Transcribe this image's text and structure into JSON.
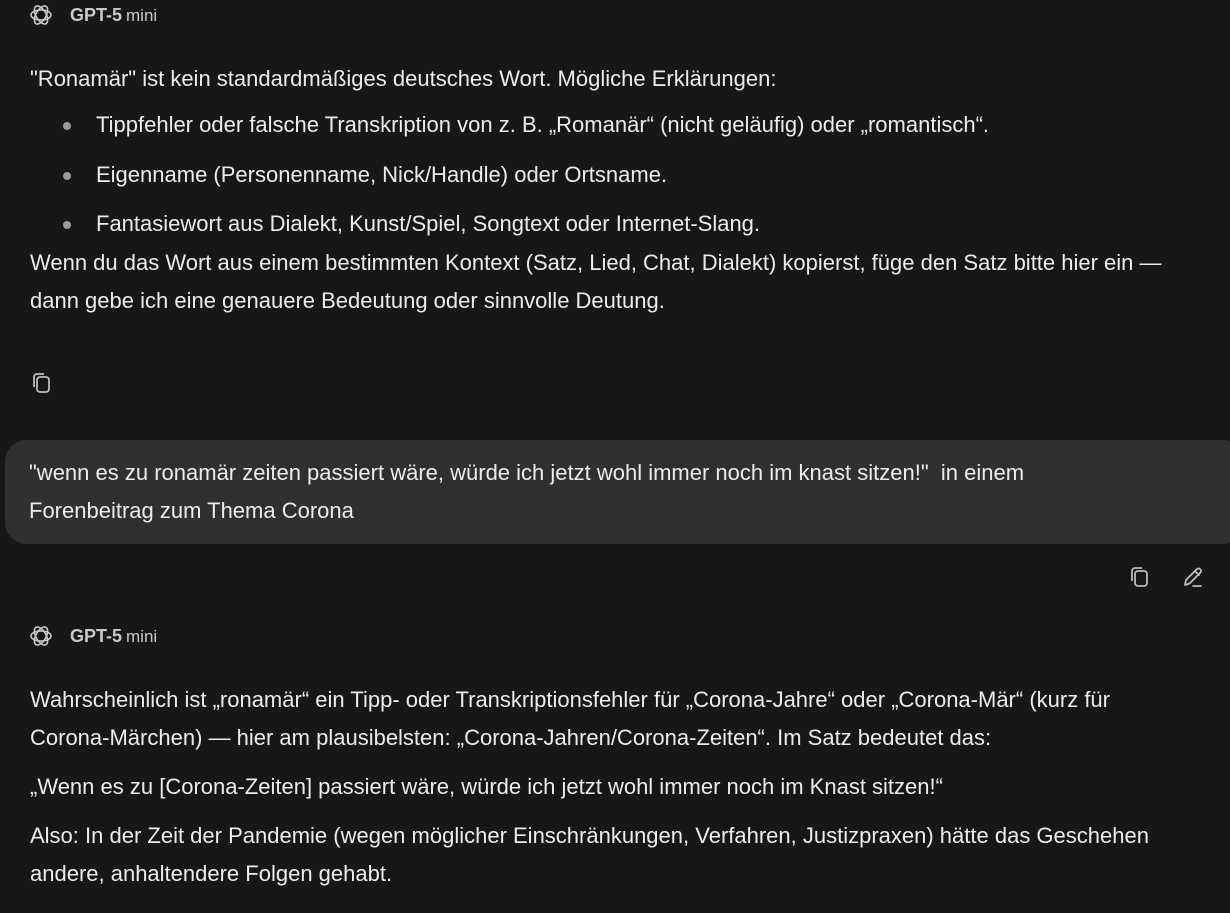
{
  "messages": [
    {
      "role": "assistant",
      "model": "GPT-5",
      "model_variant": "mini",
      "intro": "\"Ronamär\" ist kein standardmäßiges deutsches Wort. Mögliche Erklärungen:",
      "bullets": [
        "Tippfehler oder falsche Transkription von z. B. „Romanär“ (nicht geläufig) oder „romantisch“.",
        "Eigenname (Personenname, Nick/Handle) oder Ortsname.",
        "Fantasiewort aus Dialekt, Kunst/Spiel, Songtext oder Internet-Slang."
      ],
      "closing": "Wenn du das Wort aus einem bestimmten Kontext (Satz, Lied, Chat, Dialekt) kopierst, füge den Satz bitte hier ein — dann gebe ich eine genauere Bedeutung oder sinnvolle Deutung."
    },
    {
      "role": "user",
      "text": "\"wenn es zu ronamär zeiten passiert wäre, würde ich jetzt wohl immer noch im knast sitzen!\"  in einem Forenbeitrag zum Thema Corona"
    },
    {
      "role": "assistant",
      "model": "GPT-5",
      "model_variant": "mini",
      "paragraphs": [
        "Wahrscheinlich ist „ronamär“ ein Tipp- oder Transkriptionsfehler für „Corona-Jahre“ oder „Corona-Mär“ (kurz für Corona-Märchen) — hier am plausibelsten: „Corona-Jahren/Corona-Zeiten“. Im Satz bedeutet das:",
        "„Wenn es zu [Corona-Zeiten] passiert wäre, würde ich jetzt wohl immer noch im Knast sitzen!“",
        "Also: In der Zeit der Pandemie (wegen möglicher Einschränkungen, Verfahren, Justizpraxen) hätte das Geschehen andere, anhaltendere Folgen gehabt."
      ]
    }
  ],
  "icons": {
    "logo": "openai-logo-icon",
    "copy": "copy-icon",
    "edit": "edit-pencil-icon"
  }
}
